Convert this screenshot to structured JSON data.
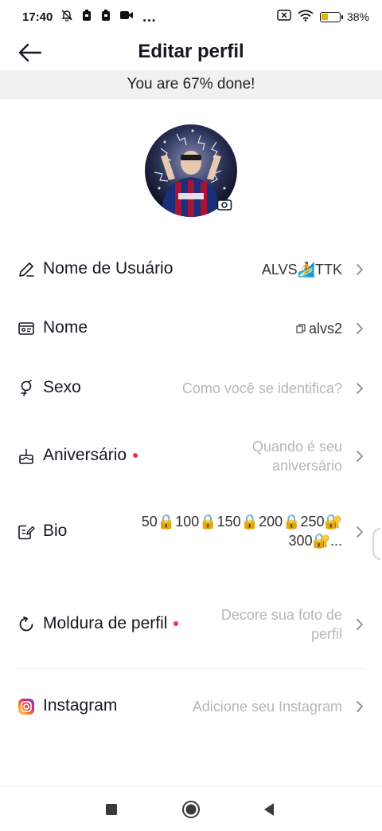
{
  "status_bar": {
    "time": "17:40",
    "overflow": "…",
    "battery_text": "38%",
    "battery_level": 0.38,
    "icons": [
      "mute-icon",
      "notification-icon",
      "notification-icon",
      "video-icon",
      "sim-off-icon",
      "wifi-icon",
      "battery-icon"
    ]
  },
  "header": {
    "title": "Editar perfil",
    "back_icon": "arrow-left-icon"
  },
  "banner": {
    "progress_text": "You are 67% done!",
    "progress_percent": 67
  },
  "profile": {
    "avatar_icon": "avatar",
    "camera_icon": "camera-icon"
  },
  "fields": {
    "username": {
      "label": "Nome de Usuário",
      "value": "ALVS🏄TTK",
      "icon": "pencil-icon"
    },
    "name": {
      "label": "Nome",
      "value": "alvs2",
      "copy_icon": "copy-icon",
      "icon": "id-card-icon"
    },
    "gender": {
      "label": "Sexo",
      "value": "Como você se identifica?",
      "icon": "gender-icon"
    },
    "birthday": {
      "label": "Aniversário",
      "value_line1": "Quando é seu",
      "value_line2": "aniversário",
      "icon": "cake-icon"
    },
    "bio": {
      "label": "Bio",
      "value_line1": "50🔒100🔒150🔒200🔒250🔐",
      "value_line2": "300🔐...",
      "icon": "edit-note-icon"
    },
    "frame": {
      "label": "Moldura de perfil",
      "value_line1": "Decore sua foto de",
      "value_line2": "perfil",
      "icon": "frame-icon"
    },
    "instagram": {
      "label": "Instagram",
      "value": "Adicione seu Instagram",
      "icon": "instagram-icon"
    }
  },
  "nav": {
    "recents": "recents-square-icon",
    "home": "home-circle-icon",
    "back": "back-triangle-icon"
  },
  "colors": {
    "accent_dot": "#fe2c55",
    "text_primary": "#161823",
    "placeholder": "#b6b6bc",
    "banner_bg": "#f1f1f2"
  }
}
